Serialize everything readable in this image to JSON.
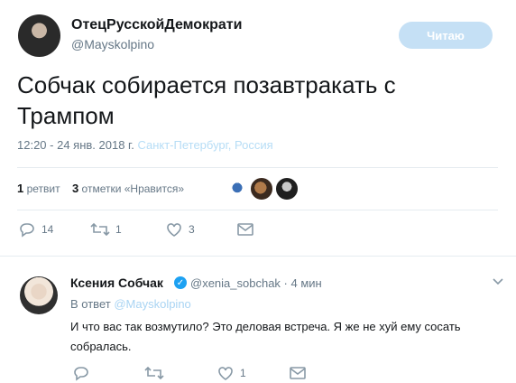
{
  "tweet": {
    "author_name": "ОтецРусскойДемократи",
    "author_handle": "@Mayskolpino",
    "follow_label": "Читаю",
    "text": "Собчак собирается позавтракать с Трампом",
    "time_date": "12:20 - 24 янв. 2018 г.",
    "location": "Санкт-Петербург, Россия",
    "retweet_count": "1",
    "retweet_label": "ретвит",
    "like_count": "3",
    "like_label": "отметки «Нравится»",
    "actions": {
      "reply": "14",
      "retweet": "1",
      "like": "3"
    }
  },
  "reply": {
    "author_name": "Ксения Собчак",
    "author_handle": "@xenia_sobchak · 4 мин",
    "reply_to_label": "В ответ",
    "reply_to_handle": "@Mayskolpino",
    "text": "И что вас так возмутило? Это деловая встреча. Я же не хуй ему сосать собралась.",
    "actions": {
      "like": "1"
    }
  },
  "colors": {
    "accent": "#1da1f2",
    "muted": "#657786",
    "follow_bg": "#c5e0f5"
  }
}
